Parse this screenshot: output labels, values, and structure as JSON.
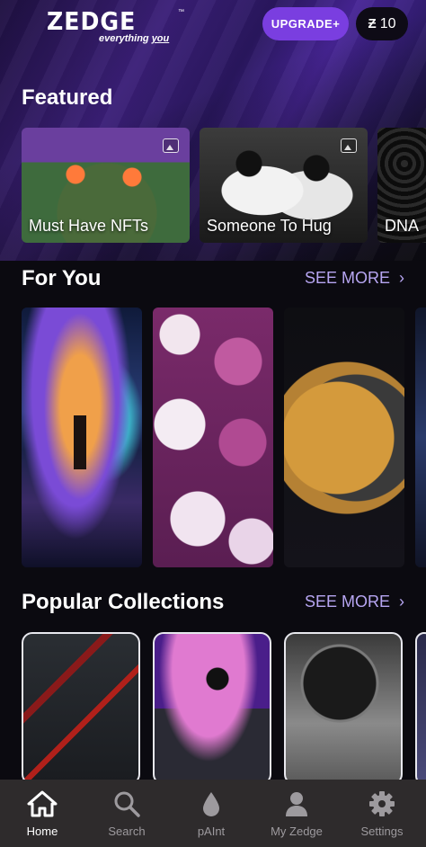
{
  "header": {
    "logo_word": "ZEDGE",
    "logo_tm": "™",
    "logo_tag_prefix": "everything ",
    "logo_tag_highlight": "you",
    "upgrade_label": "UPGRADE+",
    "coin_symbol": "Ƶ",
    "coin_count": "10"
  },
  "featured": {
    "title": "Featured",
    "cards": [
      {
        "label": "Must Have NFTs"
      },
      {
        "label": "Someone To Hug"
      },
      {
        "label": "DNA"
      }
    ]
  },
  "for_you": {
    "title": "For You",
    "see_more": "SEE MORE",
    "chevron": "›"
  },
  "popular_collections": {
    "title": "Popular Collections",
    "see_more": "SEE MORE",
    "chevron": "›"
  },
  "tabbar": {
    "items": [
      {
        "label": "Home",
        "icon": "home-icon",
        "active": true
      },
      {
        "label": "Search",
        "icon": "search-icon",
        "active": false
      },
      {
        "label": "pAInt",
        "icon": "drop-icon",
        "active": false
      },
      {
        "label": "My Zedge",
        "icon": "person-icon",
        "active": false
      },
      {
        "label": "Settings",
        "icon": "gear-icon",
        "active": false
      }
    ]
  },
  "colors": {
    "accent": "#7a3ee0",
    "see_more": "#b7a6f2",
    "tabbar_bg": "#2e2b2c",
    "tab_inactive": "#9d9a9e",
    "tab_active": "#ffffff"
  }
}
